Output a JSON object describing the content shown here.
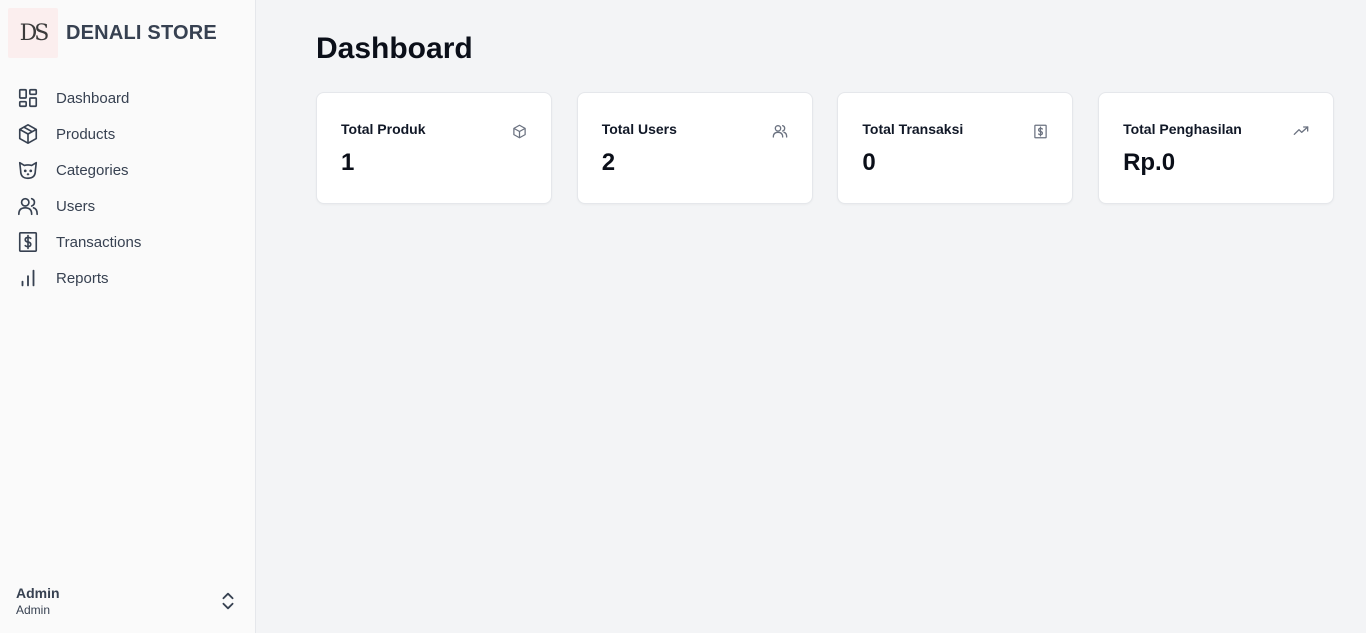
{
  "sidebar": {
    "brand": {
      "logo_text": "DS",
      "name": "DENALI STORE"
    },
    "items": [
      {
        "label": "Dashboard",
        "icon": "dashboard-grid-icon"
      },
      {
        "label": "Products",
        "icon": "package-icon"
      },
      {
        "label": "Categories",
        "icon": "cat-icon"
      },
      {
        "label": "Users",
        "icon": "users-icon"
      },
      {
        "label": "Transactions",
        "icon": "receipt-icon"
      },
      {
        "label": "Reports",
        "icon": "bar-chart-icon"
      }
    ],
    "user": {
      "name": "Admin",
      "role": "Admin",
      "toggle_icon": "chevrons-up-down-icon"
    }
  },
  "main": {
    "title": "Dashboard",
    "cards": [
      {
        "label": "Total Produk",
        "value": "1",
        "icon": "package-icon"
      },
      {
        "label": "Total Users",
        "value": "2",
        "icon": "users-icon"
      },
      {
        "label": "Total Transaksi",
        "value": "0",
        "icon": "receipt-icon"
      },
      {
        "label": "Total Penghasilan",
        "value": "Rp.0",
        "icon": "trending-up-icon"
      }
    ]
  },
  "colors": {
    "sidebar_bg": "#fafafa",
    "main_bg": "#f3f4f6",
    "card_bg": "#ffffff",
    "text_primary": "#111827",
    "text_secondary": "#374151",
    "icon_muted": "#6b7280"
  }
}
